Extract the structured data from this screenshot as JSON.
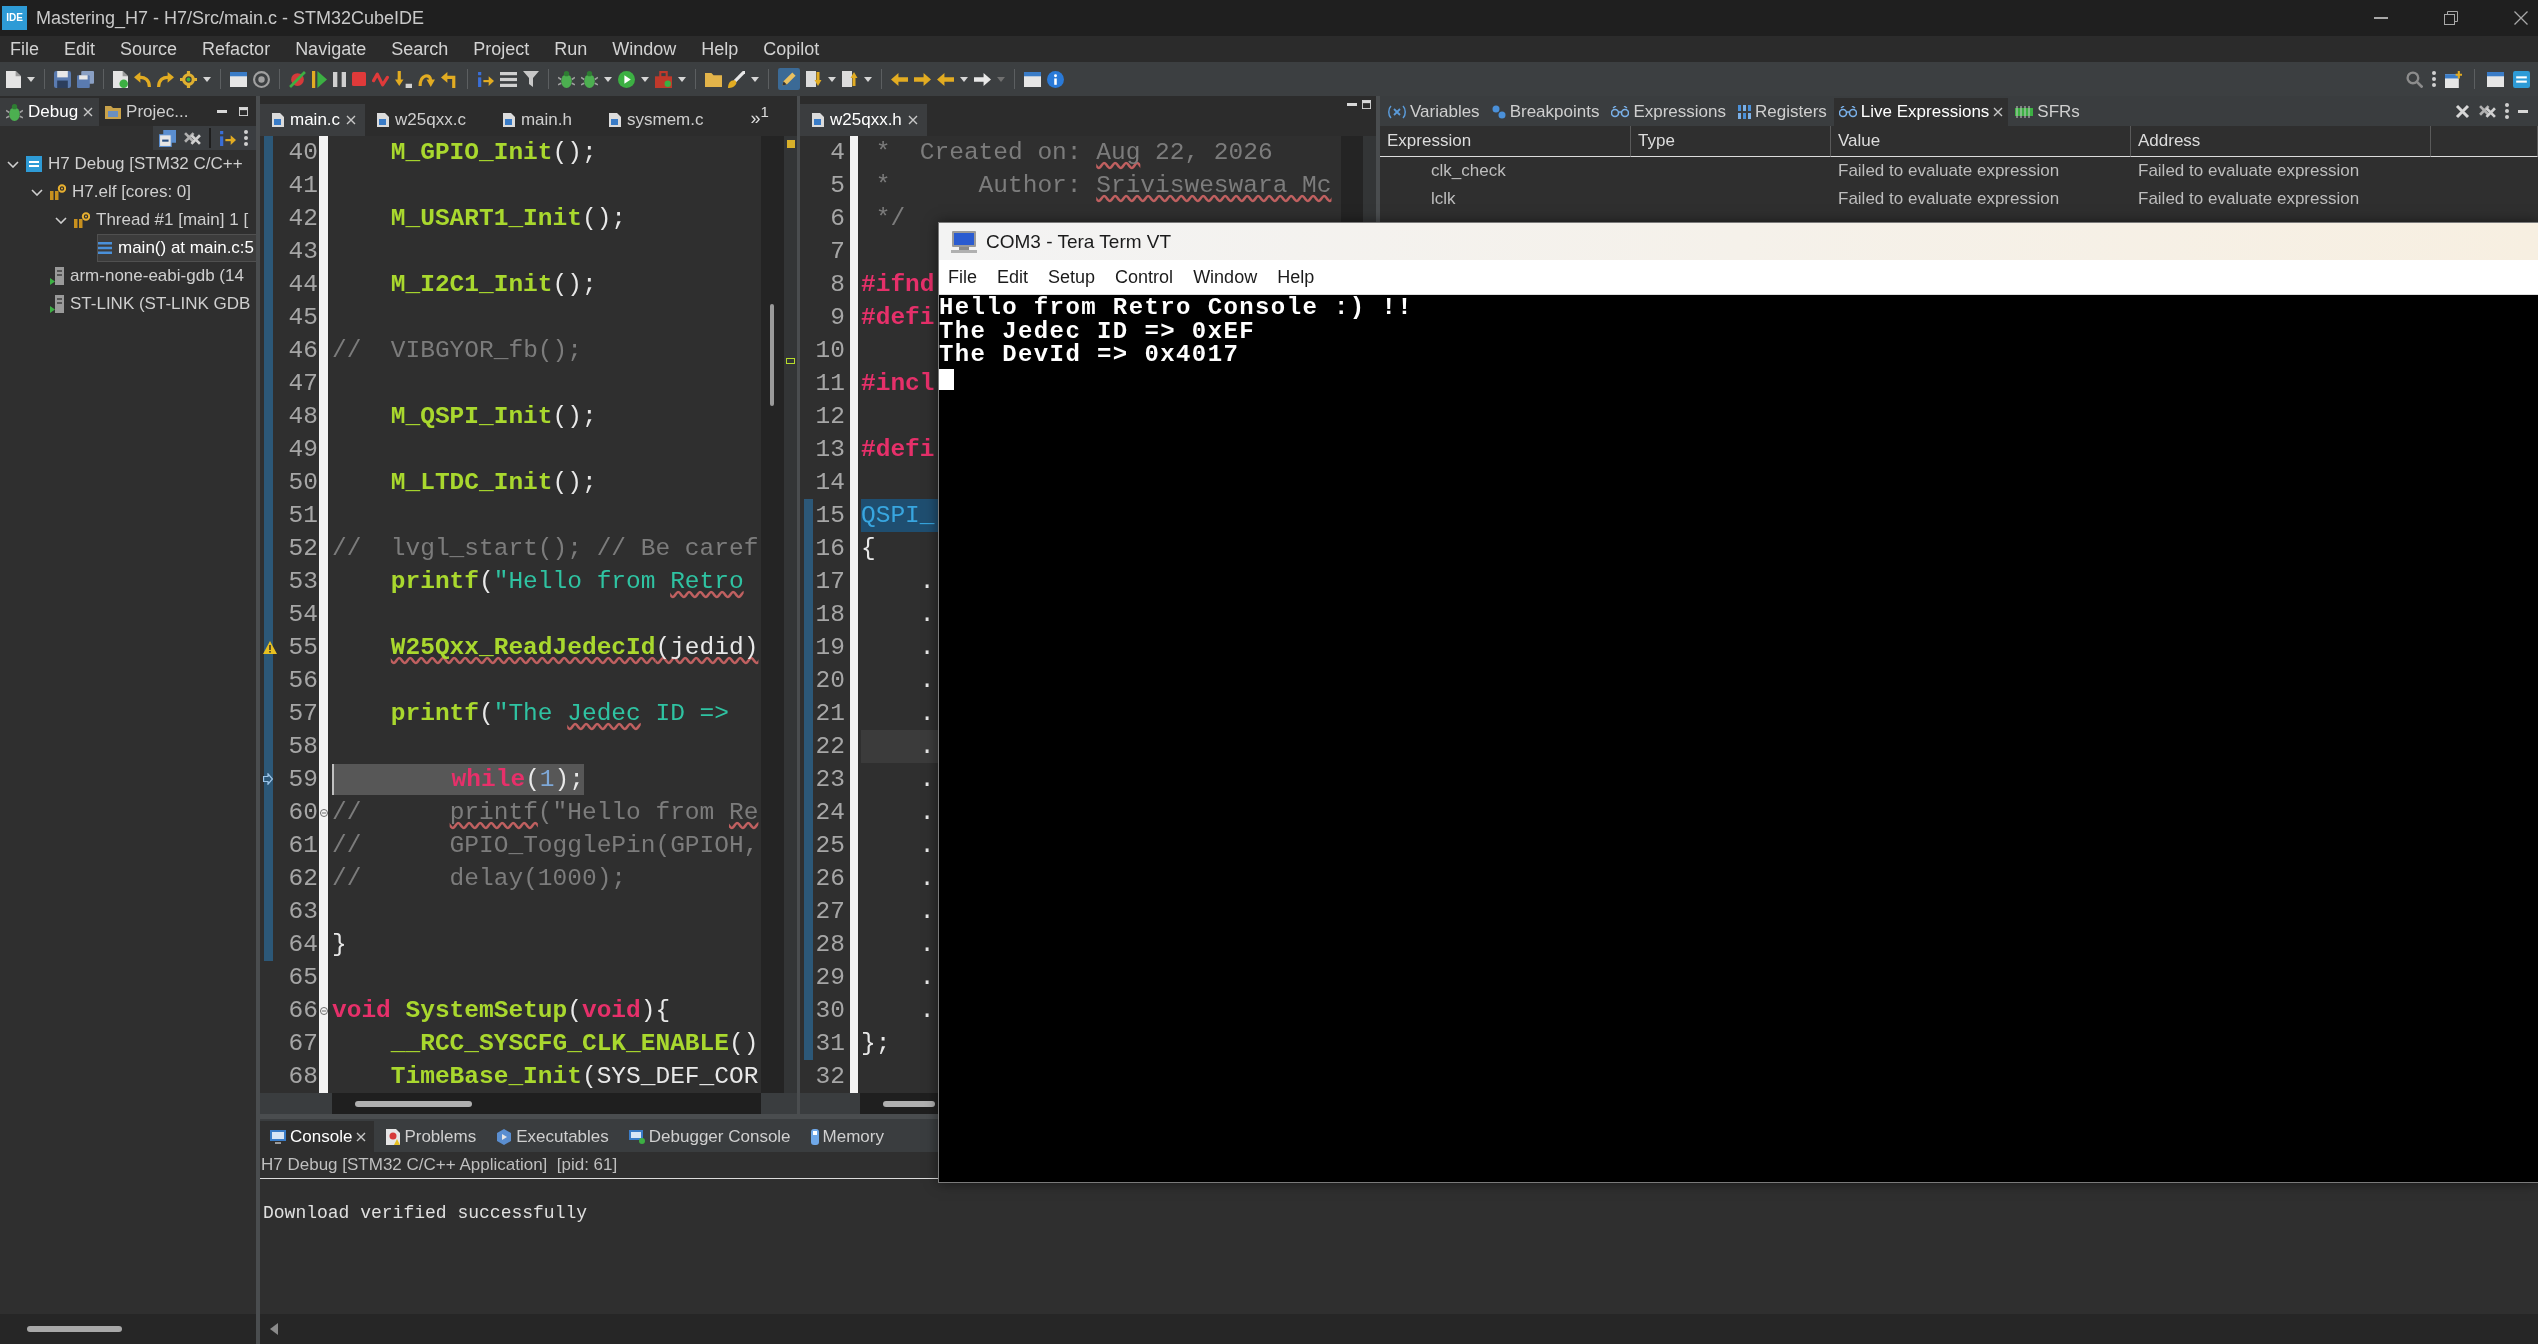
{
  "window": {
    "logo": "IDE",
    "title": "Mastering_H7 - H7/Src/main.c - STM32CubeIDE"
  },
  "menu": [
    "File",
    "Edit",
    "Source",
    "Refactor",
    "Navigate",
    "Search",
    "Project",
    "Run",
    "Window",
    "Help",
    "Copilot"
  ],
  "debug_view": {
    "tabs": [
      {
        "label": "Debug",
        "selected": true
      },
      {
        "label": "Projec...",
        "selected": false
      }
    ],
    "tree": [
      {
        "label": "H7 Debug [STM32 C/C++",
        "kind": "launch",
        "expanded": true,
        "selected": false,
        "children": [
          {
            "label": "H7.elf [cores: 0]",
            "kind": "process",
            "expanded": true,
            "selected": false,
            "children": [
              {
                "label": "Thread #1 [main] 1 [",
                "kind": "thread",
                "expanded": true,
                "selected": false,
                "children": [
                  {
                    "label": "main() at main.c:5",
                    "kind": "frame",
                    "selected": true
                  }
                ]
              }
            ]
          },
          {
            "label": "arm-none-eabi-gdb (14",
            "kind": "tool",
            "selected": false
          },
          {
            "label": "ST-LINK (ST-LINK GDB",
            "kind": "tool",
            "selected": false
          }
        ]
      }
    ]
  },
  "editors": [
    {
      "tabs": [
        {
          "label": "main.c",
          "selected": true
        },
        {
          "label": "w25qxx.c",
          "selected": false
        },
        {
          "label": "main.h",
          "selected": false
        },
        {
          "label": "sysmem.c",
          "selected": false
        }
      ],
      "overflow": {
        "chevron": "»",
        "count": "1"
      },
      "lines": [
        {
          "number": "40",
          "kind": "plain",
          "changed": true,
          "tokens": [
            {
              "text": "    M_GPIO_Init",
              "kind": "function",
              "squiggle": false
            },
            {
              "text": "();",
              "kind": "plain",
              "squiggle": false
            }
          ]
        },
        {
          "number": "41",
          "kind": "plain",
          "changed": true
        },
        {
          "number": "42",
          "kind": "plain",
          "changed": true,
          "tokens": [
            {
              "text": "    M_USART1_Init",
              "kind": "function",
              "squiggle": false
            },
            {
              "text": "();",
              "kind": "plain",
              "squiggle": false
            }
          ]
        },
        {
          "number": "43",
          "kind": "plain",
          "changed": true
        },
        {
          "number": "44",
          "kind": "plain",
          "changed": true,
          "tokens": [
            {
              "text": "    M_I2C1_Init",
              "kind": "function",
              "squiggle": false
            },
            {
              "text": "();",
              "kind": "plain",
              "squiggle": false
            }
          ]
        },
        {
          "number": "45",
          "kind": "plain",
          "changed": true
        },
        {
          "number": "46",
          "kind": "plain",
          "changed": true,
          "tokens": [
            {
              "text": "//  VIBGYOR_fb();",
              "kind": "comment",
              "squiggle": false
            }
          ]
        },
        {
          "number": "47",
          "kind": "plain",
          "changed": true
        },
        {
          "number": "48",
          "kind": "plain",
          "changed": true,
          "tokens": [
            {
              "text": "    M_QSPI_Init",
              "kind": "function",
              "squiggle": false
            },
            {
              "text": "();",
              "kind": "plain",
              "squiggle": false
            }
          ]
        },
        {
          "number": "49",
          "kind": "plain",
          "changed": true
        },
        {
          "number": "50",
          "kind": "plain",
          "changed": true,
          "tokens": [
            {
              "text": "    M_LTDC_Init",
              "kind": "function",
              "squiggle": false
            },
            {
              "text": "();",
              "kind": "plain",
              "squiggle": false
            }
          ]
        },
        {
          "number": "51",
          "kind": "plain",
          "changed": true
        },
        {
          "number": "52",
          "kind": "plain",
          "changed": true,
          "tokens": [
            {
              "text": "//  lvgl_start(); // Be caref",
              "kind": "comment",
              "squiggle": false
            }
          ]
        },
        {
          "number": "53",
          "kind": "plain",
          "changed": true,
          "tokens": [
            {
              "text": "    printf",
              "kind": "function",
              "squiggle": false
            },
            {
              "text": "(",
              "kind": "plain",
              "squiggle": false
            },
            {
              "text": "\"Hello from ",
              "kind": "string",
              "squiggle": false
            },
            {
              "text": "Retro",
              "kind": "string",
              "squiggle": true
            }
          ]
        },
        {
          "number": "54",
          "kind": "plain",
          "changed": true
        },
        {
          "number": "55",
          "kind": "warning",
          "changed": true,
          "tokens": [
            {
              "text": "    W25Qxx_ReadJedecId",
              "kind": "function",
              "squiggle": true
            },
            {
              "text": "(jedid)",
              "kind": "plain",
              "squiggle": true
            }
          ]
        },
        {
          "number": "56",
          "kind": "plain",
          "changed": true
        },
        {
          "number": "57",
          "kind": "plain",
          "changed": true,
          "tokens": [
            {
              "text": "    printf",
              "kind": "function",
              "squiggle": false
            },
            {
              "text": "(",
              "kind": "plain",
              "squiggle": false
            },
            {
              "text": "\"The ",
              "kind": "string",
              "squiggle": false
            },
            {
              "text": "Jedec",
              "kind": "string",
              "squiggle": true
            },
            {
              "text": " ID =>",
              "kind": "string",
              "squiggle": false
            }
          ]
        },
        {
          "number": "58",
          "kind": "plain",
          "changed": true
        },
        {
          "number": "59",
          "kind": "instruction",
          "changed": true,
          "tokens": [
            {
              "text": "        while",
              "kind": "keyword",
              "squiggle": false
            },
            {
              "text": "(",
              "kind": "plain",
              "squiggle": false
            },
            {
              "text": "1",
              "kind": "number",
              "squiggle": false
            },
            {
              "text": ");",
              "kind": "plain",
              "squiggle": false
            }
          ]
        },
        {
          "number": "60",
          "kind": "fold",
          "changed": true,
          "tokens": [
            {
              "text": "//      ",
              "kind": "comment",
              "squiggle": false
            },
            {
              "text": "printf",
              "kind": "comment",
              "squiggle": true
            },
            {
              "text": "(\"Hello from ",
              "kind": "comment",
              "squiggle": false
            },
            {
              "text": "Re",
              "kind": "comment",
              "squiggle": true
            }
          ]
        },
        {
          "number": "61",
          "kind": "plain",
          "changed": true,
          "tokens": [
            {
              "text": "//      GPIO_TogglePin(GPIOH,",
              "kind": "comment",
              "squiggle": false
            }
          ]
        },
        {
          "number": "62",
          "kind": "plain",
          "changed": true,
          "tokens": [
            {
              "text": "//      delay(1000);",
              "kind": "comment",
              "squiggle": false
            }
          ]
        },
        {
          "number": "63",
          "kind": "plain",
          "changed": true
        },
        {
          "number": "64",
          "kind": "plain",
          "changed": true,
          "tokens": [
            {
              "text": "}",
              "kind": "plain",
              "squiggle": false
            }
          ]
        },
        {
          "number": "65",
          "kind": "plain",
          "changed": false
        },
        {
          "number": "66",
          "kind": "fold",
          "changed": false,
          "tokens": [
            {
              "text": "void ",
              "kind": "keyword",
              "squiggle": false
            },
            {
              "text": "SystemSetup",
              "kind": "function",
              "squiggle": false
            },
            {
              "text": "(",
              "kind": "plain",
              "squiggle": false
            },
            {
              "text": "void",
              "kind": "keyword",
              "squiggle": false
            },
            {
              "text": "){",
              "kind": "plain",
              "squiggle": false
            }
          ]
        },
        {
          "number": "67",
          "kind": "plain",
          "changed": false,
          "tokens": [
            {
              "text": "    __RCC_SYSCFG_CLK_ENABLE",
              "kind": "function",
              "squiggle": false
            },
            {
              "text": "()",
              "kind": "plain",
              "squiggle": false
            }
          ]
        },
        {
          "number": "68",
          "kind": "plain",
          "changed": false,
          "tokens": [
            {
              "text": "    TimeBase_Init",
              "kind": "function",
              "squiggle": false
            },
            {
              "text": "(SYS_DEF_COR",
              "kind": "plain",
              "squiggle": false
            }
          ]
        }
      ]
    },
    {
      "tabs": [
        {
          "label": "w25qxx.h",
          "selected": true
        }
      ],
      "lines": [
        {
          "number": "4",
          "kind": "plain",
          "changed": false,
          "tokens": [
            {
              "text": " *  Created on: ",
              "kind": "comment",
              "squiggle": false
            },
            {
              "text": "Aug",
              "kind": "comment",
              "squiggle": true
            },
            {
              "text": " 22, 2026",
              "kind": "comment",
              "squiggle": false
            }
          ]
        },
        {
          "number": "5",
          "kind": "plain",
          "changed": false,
          "tokens": [
            {
              "text": " *      Author: ",
              "kind": "comment",
              "squiggle": false
            },
            {
              "text": "Srivisweswara Mc",
              "kind": "comment",
              "squiggle": true
            }
          ]
        },
        {
          "number": "6",
          "kind": "plain",
          "changed": false,
          "tokens": [
            {
              "text": " */",
              "kind": "comment",
              "squiggle": false
            }
          ]
        },
        {
          "number": "7",
          "kind": "plain",
          "changed": false
        },
        {
          "number": "8",
          "kind": "plain",
          "changed": false,
          "tokens": [
            {
              "text": "#ifnd",
              "kind": "directive",
              "squiggle": false
            }
          ]
        },
        {
          "number": "9",
          "kind": "plain",
          "changed": false,
          "tokens": [
            {
              "text": "#defi",
              "kind": "directive",
              "squiggle": false
            }
          ]
        },
        {
          "number": "10",
          "kind": "plain",
          "changed": false
        },
        {
          "number": "11",
          "kind": "plain",
          "changed": false,
          "tokens": [
            {
              "text": "#incl",
              "kind": "directive",
              "squiggle": false
            }
          ]
        },
        {
          "number": "12",
          "kind": "plain",
          "changed": false
        },
        {
          "number": "13",
          "kind": "plain",
          "changed": false,
          "tokens": [
            {
              "text": "#defi",
              "kind": "directive",
              "squiggle": false
            }
          ]
        },
        {
          "number": "14",
          "kind": "plain",
          "changed": false
        },
        {
          "number": "15",
          "kind": "occurrence",
          "changed": true,
          "tokens": [
            {
              "text": "QSPI_",
              "kind": "type",
              "squiggle": false
            }
          ]
        },
        {
          "number": "16",
          "kind": "plain",
          "changed": true,
          "tokens": [
            {
              "text": "{",
              "kind": "plain",
              "squiggle": false
            }
          ]
        },
        {
          "number": "17",
          "kind": "plain",
          "changed": true,
          "tokens": [
            {
              "text": "    .",
              "kind": "plain",
              "squiggle": false
            }
          ]
        },
        {
          "number": "18",
          "kind": "plain",
          "changed": true,
          "tokens": [
            {
              "text": "    .",
              "kind": "plain",
              "squiggle": false
            }
          ]
        },
        {
          "number": "19",
          "kind": "plain",
          "changed": true,
          "tokens": [
            {
              "text": "    .",
              "kind": "plain",
              "squiggle": false
            }
          ]
        },
        {
          "number": "20",
          "kind": "plain",
          "changed": true,
          "tokens": [
            {
              "text": "    .",
              "kind": "plain",
              "squiggle": false
            }
          ]
        },
        {
          "number": "21",
          "kind": "plain",
          "changed": true,
          "tokens": [
            {
              "text": "    .",
              "kind": "plain",
              "squiggle": false
            }
          ]
        },
        {
          "number": "22",
          "kind": "cursor",
          "changed": true,
          "tokens": [
            {
              "text": "    .",
              "kind": "plain",
              "squiggle": false
            }
          ]
        },
        {
          "number": "23",
          "kind": "plain",
          "changed": true,
          "tokens": [
            {
              "text": "    .",
              "kind": "plain",
              "squiggle": false
            }
          ]
        },
        {
          "number": "24",
          "kind": "plain",
          "changed": true,
          "tokens": [
            {
              "text": "    .",
              "kind": "plain",
              "squiggle": false
            }
          ]
        },
        {
          "number": "25",
          "kind": "plain",
          "changed": true,
          "tokens": [
            {
              "text": "    .",
              "kind": "plain",
              "squiggle": false
            }
          ]
        },
        {
          "number": "26",
          "kind": "plain",
          "changed": true,
          "tokens": [
            {
              "text": "    .",
              "kind": "plain",
              "squiggle": false
            }
          ]
        },
        {
          "number": "27",
          "kind": "plain",
          "changed": true,
          "tokens": [
            {
              "text": "    .",
              "kind": "plain",
              "squiggle": false
            }
          ]
        },
        {
          "number": "28",
          "kind": "plain",
          "changed": true,
          "tokens": [
            {
              "text": "    .",
              "kind": "plain",
              "squiggle": false
            }
          ]
        },
        {
          "number": "29",
          "kind": "plain",
          "changed": true,
          "tokens": [
            {
              "text": "    .",
              "kind": "plain",
              "squiggle": false
            }
          ]
        },
        {
          "number": "30",
          "kind": "plain",
          "changed": true,
          "tokens": [
            {
              "text": "    .",
              "kind": "plain",
              "squiggle": false
            }
          ]
        },
        {
          "number": "31",
          "kind": "plain",
          "changed": true,
          "tokens": [
            {
              "text": "};",
              "kind": "plain",
              "squiggle": false
            }
          ]
        },
        {
          "number": "32",
          "kind": "plain",
          "changed": false
        }
      ]
    }
  ],
  "expressions_view": {
    "tabs": [
      {
        "label": "Variables",
        "selected": false
      },
      {
        "label": "Breakpoints",
        "selected": false
      },
      {
        "label": "Expressions",
        "selected": false
      },
      {
        "label": "Registers",
        "selected": false
      },
      {
        "label": "Live Expressions",
        "selected": true
      },
      {
        "label": "SFRs",
        "selected": false
      }
    ],
    "columns": [
      "Expression",
      "Type",
      "Value",
      "Address"
    ],
    "rows": [
      {
        "expression": "clk_check",
        "value": "Failed to evaluate expression",
        "address": "Failed to evaluate expression"
      },
      {
        "expression": "lclk",
        "value": "Failed to evaluate expression",
        "address": "Failed to evaluate expression"
      }
    ]
  },
  "console_view": {
    "tabs": [
      {
        "label": "Console",
        "selected": true
      },
      {
        "label": "Problems",
        "selected": false
      },
      {
        "label": "Executables",
        "selected": false
      },
      {
        "label": "Debugger Console",
        "selected": false
      },
      {
        "label": "Memory",
        "selected": false
      }
    ],
    "header": "H7 Debug [STM32 C/C++ Application]  [pid: 61]",
    "lines": [
      "Download verified successfully"
    ]
  },
  "terminal": {
    "title": "COM3 - Tera Term VT",
    "menu": [
      "File",
      "Edit",
      "Setup",
      "Control",
      "Window",
      "Help"
    ],
    "lines": [
      "Hello from Retro Console :) !!",
      "The Jedec ID => 0xEF",
      "The DevId => 0x4017"
    ]
  }
}
